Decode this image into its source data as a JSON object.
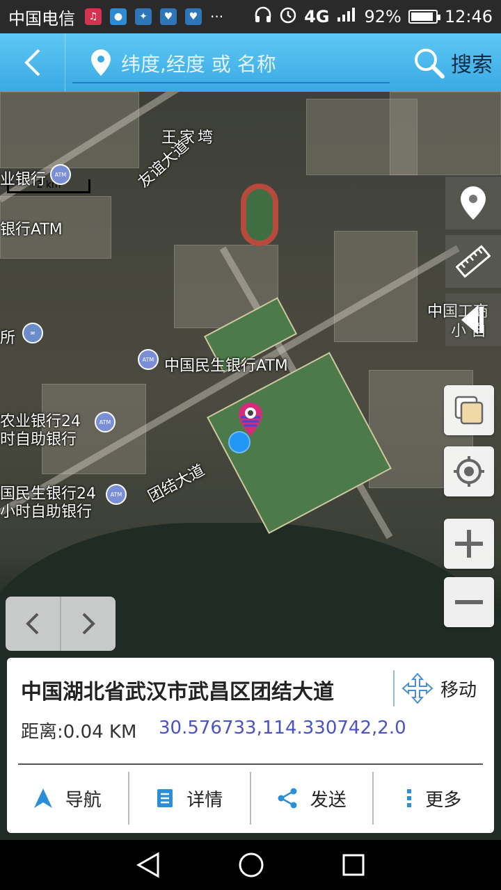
{
  "status_bar": {
    "carrier": "中国电信",
    "network": "4G",
    "battery": "92%",
    "battery_level": 0.92,
    "time": "12:46",
    "more": "···"
  },
  "header": {
    "search_placeholder": "纬度,经度 或 名称",
    "search_label": "搜索"
  },
  "map": {
    "scale_label": "2 km",
    "labels": {
      "wangjiawan": "王家塆",
      "youyi_road": "友谊大道",
      "bank_partial": "业银行",
      "bank_atm_partial": "银行ATM",
      "post_partial": "所",
      "minsheng_atm": "中国民生银行ATM",
      "agri_bank_1": "农业银行24",
      "agri_bank_2": "时自助银行",
      "minsheng24_1": "国民生银行24",
      "minsheng24_2": "小时自助银行",
      "tuanjie_road": "团结大道",
      "right_partial_1": "中国工商",
      "right_partial_2": "小 自"
    }
  },
  "info_card": {
    "address": "中国湖北省武汉市武昌区团结大道",
    "move_label": "移动",
    "distance": "距离:0.04 KM",
    "coordinates": "30.576733,114.330742,2.0",
    "actions": {
      "navigate": "导航",
      "details": "详情",
      "send": "发送",
      "more": "更多"
    }
  },
  "colors": {
    "header_top": "#5ec8f5",
    "header_bottom": "#3aa9e3",
    "coords": "#4a53c6",
    "accent_blue": "#2196f3"
  }
}
